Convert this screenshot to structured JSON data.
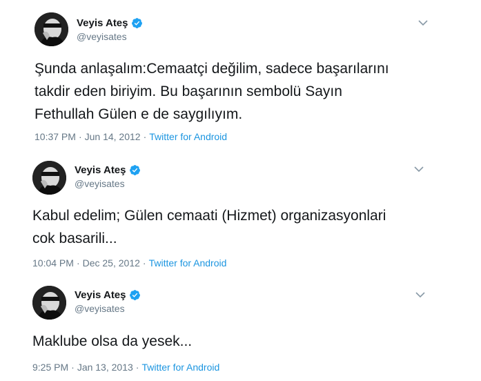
{
  "colors": {
    "text": "#14171a",
    "secondary": "#657786",
    "link": "#1b95e0",
    "verified": "#1da1f2"
  },
  "tweets": [
    {
      "display_name": "Veyis Ateş",
      "handle": "@veyisates",
      "text_lines": [
        "Şunda anlaşalım:Cemaatçi değilim, sadece başarılarını",
        "takdir eden biriyim. Bu başarının sembolü Sayın",
        "Fethullah Gülen e de saygılıyım."
      ],
      "time": "10:37 PM",
      "date": "Jun 14, 2012",
      "separator": "·",
      "source": "Twitter for Android",
      "icons": [
        "avatar",
        "verified-icon",
        "chevron-down-icon"
      ]
    },
    {
      "display_name": "Veyis Ateş",
      "handle": "@veyisates",
      "text_lines": [
        "Kabul edelim; Gülen cemaati (Hizmet) organizasyonlari",
        "cok basarili..."
      ],
      "time": "10:04 PM",
      "date": "Dec 25, 2012",
      "separator": "·",
      "source": "Twitter for Android",
      "icons": [
        "avatar",
        "verified-icon",
        "chevron-down-icon"
      ]
    },
    {
      "display_name": "Veyis Ateş",
      "handle": "@veyisates",
      "text_lines": [
        "Maklube olsa da yesek..."
      ],
      "time": "9:25 PM",
      "date": "Jan 13, 2013",
      "separator": "·",
      "source": "Twitter for Android",
      "icons": [
        "avatar",
        "verified-icon",
        "chevron-down-icon"
      ]
    }
  ]
}
